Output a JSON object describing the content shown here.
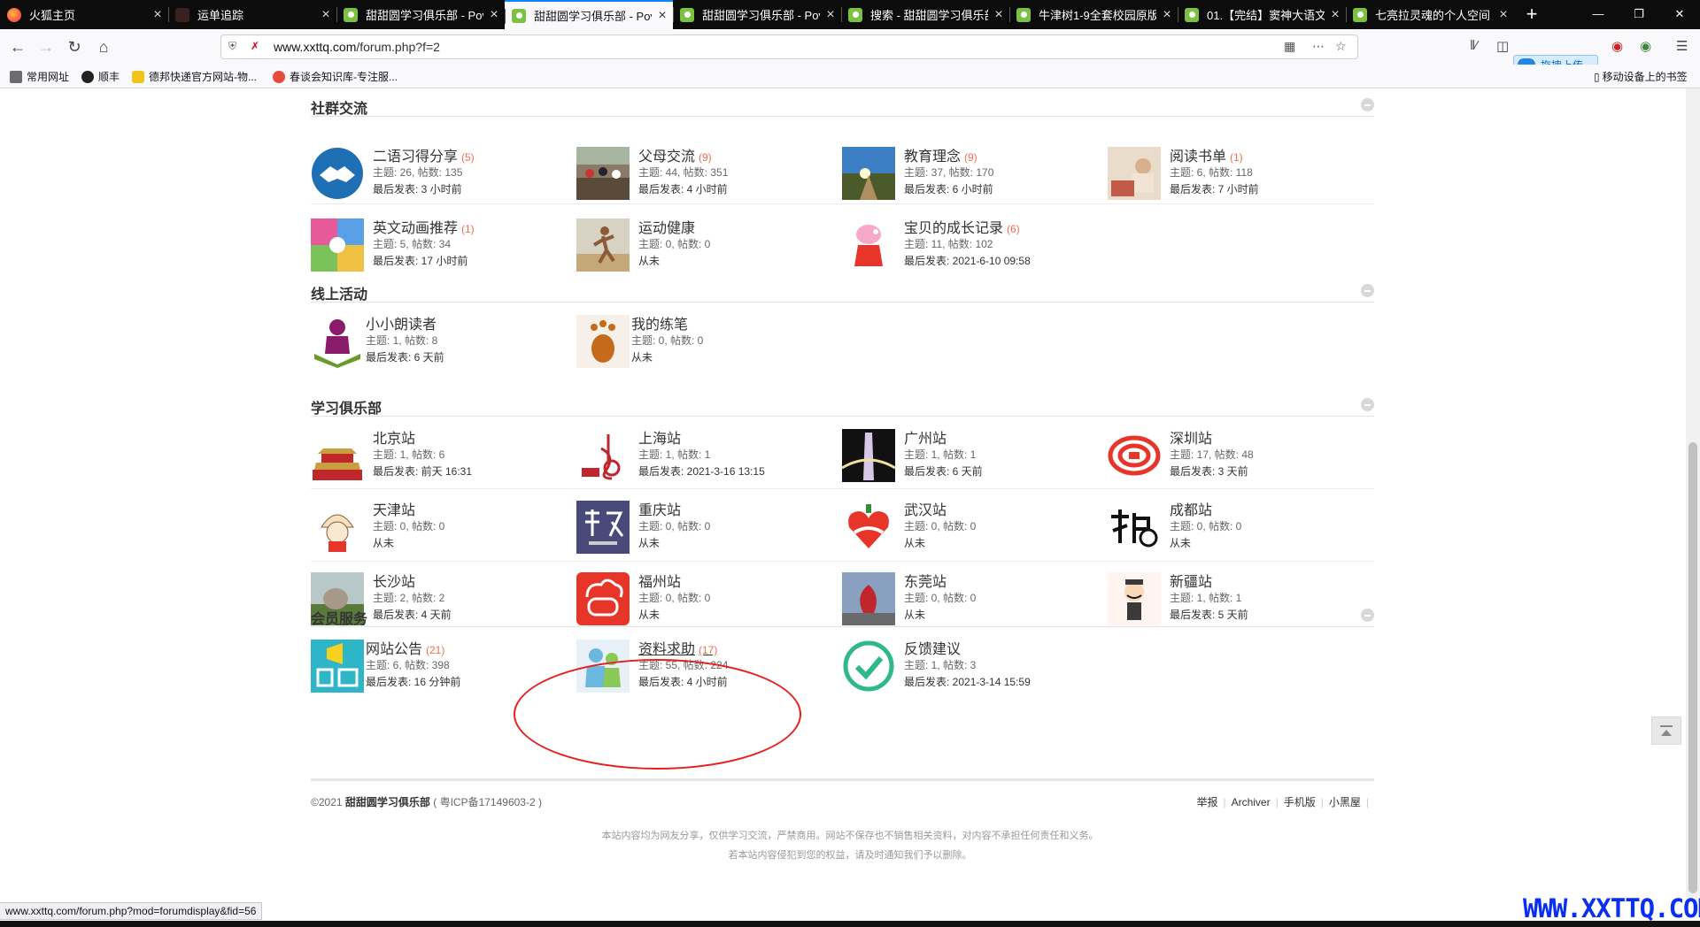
{
  "browser": {
    "tabs": [
      {
        "title": "火狐主页",
        "favicon": "firefox-icon"
      },
      {
        "title": "运单追踪",
        "favicon": "tracking-icon"
      },
      {
        "title": "甜甜圆学习俱乐部 - Pov",
        "favicon": "site-icon"
      },
      {
        "title": "甜甜圆学习俱乐部 - Pov",
        "favicon": "site-icon"
      },
      {
        "title": "甜甜圆学习俱乐部 - Pov",
        "favicon": "site-icon"
      },
      {
        "title": "搜索 - 甜甜圆学习俱乐部",
        "favicon": "site-icon"
      },
      {
        "title": "牛津树1-9全套校园原版",
        "favicon": "site-icon"
      },
      {
        "title": "01.【完结】窦神大语文",
        "favicon": "site-icon"
      },
      {
        "title": "七亮拉灵魂的个人空间",
        "favicon": "site-icon"
      }
    ],
    "active_tab": 3,
    "url_host": "www.xxttq.com",
    "url_path": "/forum.php?f=2",
    "upload_label": "拖拽上传",
    "bookmarks": [
      "常用网址",
      "顺丰",
      "德邦快递官方网站-物...",
      "春谈会知识库-专注服..."
    ],
    "mobile_bookmarks": "移动设备上的书签",
    "status_url": "www.xxttq.com/forum.php?mod=forumdisplay&fid=56"
  },
  "sections": [
    {
      "title": "社群交流",
      "forums": [
        {
          "name": "二语习得分享",
          "count": "(5)",
          "stat": "主题: 26, 帖数: 135",
          "last": "最后发表: 3 小时前",
          "icon": "handshake-icon"
        },
        {
          "name": "父母交流",
          "count": "(9)",
          "stat": "主题: 44, 帖数: 351",
          "last": "最后发表: 4 小时前",
          "icon": "marathon-photo-icon"
        },
        {
          "name": "教育理念",
          "count": "(9)",
          "stat": "主题: 37, 帖数: 170",
          "last": "最后发表: 6 小时前",
          "icon": "sunrise-photo-icon"
        },
        {
          "name": "阅读书单",
          "count": "(1)",
          "stat": "主题: 6, 帖数: 118",
          "last": "最后发表: 7 小时前",
          "icon": "reading-child-icon"
        },
        {
          "name": "英文动画推荐",
          "count": "(1)",
          "stat": "主题: 5, 帖数: 34",
          "last": "最后发表: 17 小时前",
          "icon": "cartoon-collage-icon"
        },
        {
          "name": "运动健康",
          "count": "",
          "stat": "主题: 0, 帖数: 0",
          "last": "从未",
          "icon": "runner-photo-icon"
        },
        {
          "name": "宝贝的成长记录",
          "count": "(6)",
          "stat": "主题: 11, 帖数: 102",
          "last": "最后发表: 2021-6-10 09:58",
          "icon": "peppa-pig-icon"
        }
      ]
    },
    {
      "title": "线上活动",
      "forums": [
        {
          "name": "小小朗读者",
          "count": "",
          "stat": "主题: 1, 帖数: 8",
          "last": "最后发表: 6 天前",
          "icon": "reader-book-icon"
        },
        {
          "name": "我的练笔",
          "count": "",
          "stat": "主题: 0, 帖数: 0",
          "last": "从未",
          "icon": "footprint-icon"
        }
      ]
    },
    {
      "title": "学习俱乐部",
      "forums": [
        {
          "name": "北京站",
          "count": "",
          "stat": "主题: 1, 帖数: 6",
          "last": "最后发表: 前天 16:31",
          "icon": "tiananmen-icon"
        },
        {
          "name": "上海站",
          "count": "",
          "stat": "主题: 1, 帖数: 1",
          "last": "最后发表: 2021-3-16 13:15",
          "icon": "shanghai-logo-icon"
        },
        {
          "name": "广州站",
          "count": "",
          "stat": "主题: 1, 帖数: 1",
          "last": "最后发表: 6 天前",
          "icon": "canton-tower-icon"
        },
        {
          "name": "深圳站",
          "count": "",
          "stat": "主题: 17, 帖数: 48",
          "last": "最后发表: 3 天前",
          "icon": "shenzhen-logo-icon"
        },
        {
          "name": "天津站",
          "count": "",
          "stat": "主题: 0, 帖数: 0",
          "last": "从未",
          "icon": "bun-mascot-icon"
        },
        {
          "name": "重庆站",
          "count": "",
          "stat": "主题: 0, 帖数: 0",
          "last": "从未",
          "icon": "chongqing-logo-icon"
        },
        {
          "name": "武汉站",
          "count": "",
          "stat": "主题: 0, 帖数: 0",
          "last": "从未",
          "icon": "wuhan-heart-icon"
        },
        {
          "name": "成都站",
          "count": "",
          "stat": "主题: 0, 帖数: 0",
          "last": "从未",
          "icon": "chengdu-logo-icon"
        },
        {
          "name": "长沙站",
          "count": "",
          "stat": "主题: 2, 帖数: 2",
          "last": "最后发表: 4 天前",
          "icon": "changsha-statue-icon"
        },
        {
          "name": "福州站",
          "count": "",
          "stat": "主题: 0, 帖数: 0",
          "last": "从未",
          "icon": "fuzhou-logo-icon"
        },
        {
          "name": "东莞站",
          "count": "",
          "stat": "主题: 0, 帖数: 0",
          "last": "从未",
          "icon": "dongguan-sculpture-icon"
        },
        {
          "name": "新疆站",
          "count": "",
          "stat": "主题: 1, 帖数: 1",
          "last": "最后发表: 5 天前",
          "icon": "xinjiang-cartoon-icon"
        }
      ]
    },
    {
      "title": "会员服务",
      "forums": [
        {
          "name": "网站公告",
          "count": "(21)",
          "stat": "主题: 6, 帖数: 398",
          "last": "最后发表: 16 分钟前",
          "icon": "announcement-icon"
        },
        {
          "name": "资料求助",
          "count": "(17)",
          "stat": "主题: 55, 帖数: 224",
          "last": "最后发表: 4 小时前",
          "icon": "help-users-icon"
        },
        {
          "name": "反馈建议",
          "count": "",
          "stat": "主题: 1, 帖数: 3",
          "last": "最后发表: 2021-3-14 15:59",
          "icon": "checkmark-icon"
        }
      ]
    }
  ],
  "footer": {
    "year": "©2021",
    "site_name": "甜甜圆学习俱乐部",
    "icp": "( 粤ICP备17149603-2 )",
    "links": [
      "举报",
      "Archiver",
      "手机版",
      "小黑屋"
    ],
    "notice1": "本站内容均为网友分享，仅供学习交流，严禁商用。网站不保存也不销售相关资料，对内容不承担任何责任和义务。",
    "notice2": "若本站内容侵犯到您的权益，请及时通知我们予以删除。"
  },
  "watermark": "WWW.XXTTQ.COM",
  "colors": {
    "count": "#f26c4f",
    "annotation": "#e81f1f",
    "watermark": "#0b2ff0"
  }
}
